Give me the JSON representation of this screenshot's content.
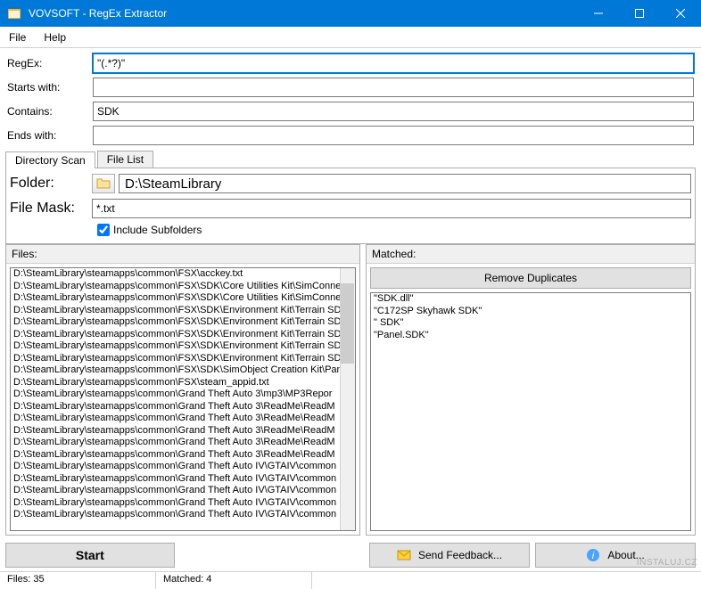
{
  "titlebar": {
    "title": "VOVSOFT - RegEx Extractor"
  },
  "menu": {
    "file": "File",
    "help": "Help"
  },
  "labels": {
    "regex": "RegEx:",
    "starts": "Starts with:",
    "contains": "Contains:",
    "ends": "Ends with:",
    "folder": "Folder:",
    "mask": "File Mask:",
    "files": "Files:",
    "matched": "Matched:"
  },
  "values": {
    "regex": "\"(.*?)\"",
    "starts": "",
    "contains": "SDK",
    "ends": "",
    "folder": "D:\\SteamLibrary",
    "mask": "*.txt",
    "include_subfolders": true
  },
  "tabs": {
    "dir": "Directory Scan",
    "filelist": "File List"
  },
  "include_sub_label": "Include Subfolders",
  "buttons": {
    "remove_dup": "Remove Duplicates",
    "start": "Start",
    "feedback": "Send Feedback...",
    "about": "About..."
  },
  "files": [
    "D:\\SteamLibrary\\steamapps\\common\\FSX\\acckey.txt",
    "D:\\SteamLibrary\\steamapps\\common\\FSX\\SDK\\Core Utilities Kit\\SimConne",
    "D:\\SteamLibrary\\steamapps\\common\\FSX\\SDK\\Core Utilities Kit\\SimConne",
    "D:\\SteamLibrary\\steamapps\\common\\FSX\\SDK\\Environment Kit\\Terrain SD",
    "D:\\SteamLibrary\\steamapps\\common\\FSX\\SDK\\Environment Kit\\Terrain SD",
    "D:\\SteamLibrary\\steamapps\\common\\FSX\\SDK\\Environment Kit\\Terrain SD",
    "D:\\SteamLibrary\\steamapps\\common\\FSX\\SDK\\Environment Kit\\Terrain SD",
    "D:\\SteamLibrary\\steamapps\\common\\FSX\\SDK\\Environment Kit\\Terrain SD",
    "D:\\SteamLibrary\\steamapps\\common\\FSX\\SDK\\SimObject Creation Kit\\Pan",
    "D:\\SteamLibrary\\steamapps\\common\\FSX\\steam_appid.txt",
    "D:\\SteamLibrary\\steamapps\\common\\Grand Theft Auto 3\\mp3\\MP3Repor",
    "D:\\SteamLibrary\\steamapps\\common\\Grand Theft Auto 3\\ReadMe\\ReadM",
    "D:\\SteamLibrary\\steamapps\\common\\Grand Theft Auto 3\\ReadMe\\ReadM",
    "D:\\SteamLibrary\\steamapps\\common\\Grand Theft Auto 3\\ReadMe\\ReadM",
    "D:\\SteamLibrary\\steamapps\\common\\Grand Theft Auto 3\\ReadMe\\ReadM",
    "D:\\SteamLibrary\\steamapps\\common\\Grand Theft Auto 3\\ReadMe\\ReadM",
    "D:\\SteamLibrary\\steamapps\\common\\Grand Theft Auto IV\\GTAIV\\common",
    "D:\\SteamLibrary\\steamapps\\common\\Grand Theft Auto IV\\GTAIV\\common",
    "D:\\SteamLibrary\\steamapps\\common\\Grand Theft Auto IV\\GTAIV\\common",
    "D:\\SteamLibrary\\steamapps\\common\\Grand Theft Auto IV\\GTAIV\\common",
    "D:\\SteamLibrary\\steamapps\\common\\Grand Theft Auto IV\\GTAIV\\common"
  ],
  "matched": [
    "\"SDK.dll\"",
    "\"C172SP Skyhawk SDK\"",
    "\" SDK\"",
    "\"Panel.SDK\""
  ],
  "status": {
    "files": "Files: 35",
    "matched": "Matched: 4"
  },
  "watermark": "INSTALUJ.CZ"
}
